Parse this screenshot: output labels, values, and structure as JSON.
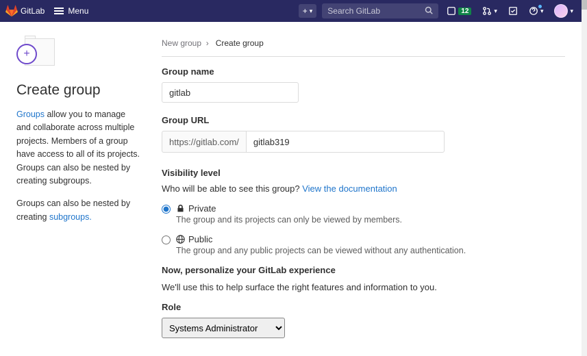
{
  "header": {
    "brand": "GitLab",
    "menu": "Menu",
    "search_placeholder": "Search GitLab",
    "issues_badge": "12"
  },
  "left": {
    "title": "Create group",
    "para1_link": "Groups",
    "para1_rest": " allow you to manage and collaborate across multiple projects. Members of a group have access to all of its projects. Groups can also be nested by creating subgroups.",
    "para2_text": "Groups can also be nested by creating ",
    "para2_link": "subgroups."
  },
  "breadcrumb": {
    "root": "New group",
    "sep": "›",
    "current": "Create group"
  },
  "form": {
    "group_name_label": "Group name",
    "group_name_value": "gitlab",
    "group_url_label": "Group URL",
    "group_url_prefix": "https://gitlab.com/",
    "group_url_value": "gitlab319",
    "visibility_label": "Visibility level",
    "visibility_help_text": "Who will be able to see this group? ",
    "visibility_help_link": "View the documentation",
    "private_label": "Private",
    "private_desc": "The group and its projects can only be viewed by members.",
    "public_label": "Public",
    "public_desc": "The group and any public projects can be viewed without any authentication.",
    "personalize_title": "Now, personalize your GitLab experience",
    "personalize_sub": "We'll use this to help surface the right features and information to you.",
    "role_label": "Role",
    "role_value": "Systems Administrator"
  }
}
